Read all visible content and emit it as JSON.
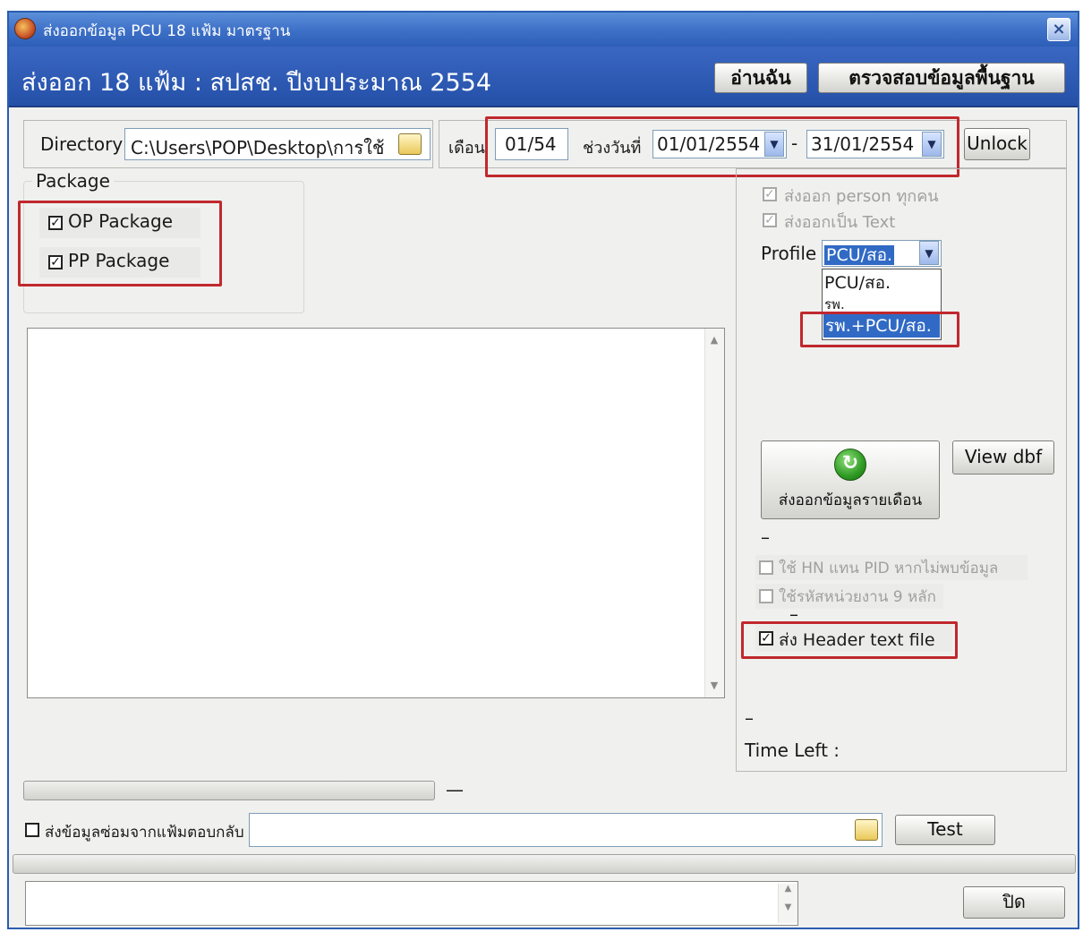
{
  "window": {
    "title": "ส่งออกข้อมูล PCU 18 แฟ้ม มาตรฐาน",
    "close_glyph": "×"
  },
  "banner": {
    "title": "ส่งออก 18 แฟ้ม : สปสช. ปีงบประมาณ 2554",
    "read_me_label": "อ่านฉัน",
    "check_base_label": "ตรวจสอบข้อมูลพื้นฐาน"
  },
  "directory": {
    "label": "Directory",
    "value": "C:\\Users\\POP\\Desktop\\การใช้"
  },
  "period": {
    "month_label": "เดือน",
    "month_value": "01/54",
    "range_label": "ช่วงวันที่",
    "date_from": "01/01/2554",
    "separator": "-",
    "date_to": "31/01/2554",
    "unlock_label": "Unlock"
  },
  "package": {
    "legend": "Package",
    "op_label": "OP Package",
    "pp_label": "PP Package"
  },
  "options": {
    "export_all_persons": "ส่งออก person ทุกคน",
    "export_as_text": "ส่งออกเป็น Text",
    "profile_label": "Profile",
    "profile_value": "PCU/สอ.",
    "profile_options": [
      "PCU/สอ.",
      "รพ.",
      "รพ.+PCU/สอ."
    ],
    "export_monthly_label": "ส่งออกข้อมูลรายเดือน",
    "view_dbf_label": "View dbf",
    "dash1": "–",
    "use_hn_label": "ใช้ HN แทน PID หากไม่พบข้อมูล",
    "use_9digit_label": "ใช้รหัสหน่วยงาน 9 หลัก",
    "dash2": "–",
    "send_header_label": "ส่ง Header text file",
    "dash3": "–",
    "time_left_label": "Time Left :"
  },
  "bottom": {
    "progress_dash": "—",
    "repair_label": "ส่งข้อมูลซ่อมจากแฟ้มตอบกลับ",
    "test_label": "Test",
    "close_label": "ปิด"
  },
  "colors": {
    "banner": "#2450a8",
    "highlight_border": "#c0282e",
    "selection": "#316ac5"
  }
}
